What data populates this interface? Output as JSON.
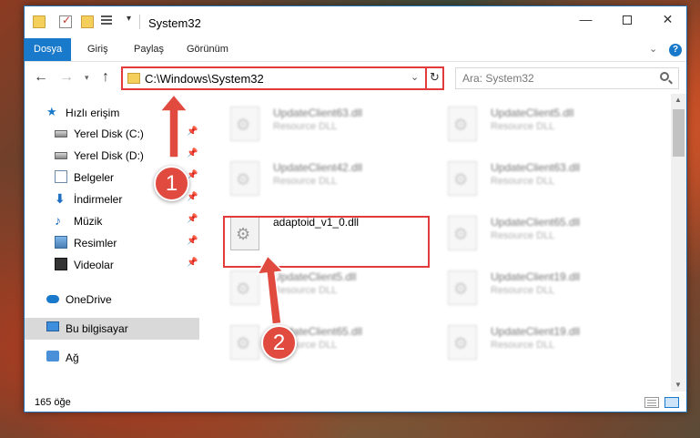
{
  "window": {
    "title": "System32",
    "controls": {
      "minimize": "—",
      "close": "✕"
    }
  },
  "ribbon": {
    "tabs": [
      {
        "label": "Dosya",
        "active": true
      },
      {
        "label": "Giriş",
        "active": false
      },
      {
        "label": "Paylaş",
        "active": false
      },
      {
        "label": "Görünüm",
        "active": false
      }
    ],
    "help": "?"
  },
  "navigation": {
    "address": "C:\\Windows\\System32",
    "search_placeholder": "Ara: System32"
  },
  "sidebar": {
    "items": [
      {
        "label": "Hızlı erişim",
        "icon": "star-icon"
      },
      {
        "label": "Yerel Disk (C:)",
        "icon": "disk-icon",
        "pinned": true
      },
      {
        "label": "Yerel Disk (D:)",
        "icon": "disk-icon",
        "pinned": true
      },
      {
        "label": "Belgeler",
        "icon": "documents-icon",
        "pinned": true
      },
      {
        "label": "İndirmeler",
        "icon": "download-icon",
        "pinned": true
      },
      {
        "label": "Müzik",
        "icon": "music-icon",
        "pinned": true
      },
      {
        "label": "Resimler",
        "icon": "pictures-icon",
        "pinned": true
      },
      {
        "label": "Videolar",
        "icon": "videos-icon",
        "pinned": true
      },
      {
        "label": "OneDrive",
        "icon": "cloud-icon"
      },
      {
        "label": "Bu bilgisayar",
        "icon": "computer-icon",
        "selected": true
      },
      {
        "label": "Ağ",
        "icon": "network-icon"
      }
    ]
  },
  "files": [
    {
      "name": "UpdateClient63.dll",
      "type": "Resource DLL"
    },
    {
      "name": "UpdateClient5.dll",
      "type": "Resource DLL"
    },
    {
      "name": "UpdateClient42.dll",
      "type": "Resource DLL"
    },
    {
      "name": "UpdateClient63.dll",
      "type": "Resource DLL"
    },
    {
      "name": "adaptoid_v1_0.dll",
      "type": ""
    },
    {
      "name": "UpdateClient65.dll",
      "type": "Resource DLL"
    },
    {
      "name": "UpdateClient5.dll",
      "type": "Resource DLL"
    },
    {
      "name": "UpdateClient19.dll",
      "type": "Resource DLL"
    },
    {
      "name": "UpdateClient65.dll",
      "type": "Resource DLL"
    },
    {
      "name": "UpdateClient19.dll",
      "type": "Resource DLL"
    }
  ],
  "status": {
    "item_count": "165 öğe"
  },
  "annotations": {
    "step1": "1",
    "step2": "2"
  },
  "colors": {
    "accent": "#1979ca",
    "annotation": "#e23b3b"
  }
}
